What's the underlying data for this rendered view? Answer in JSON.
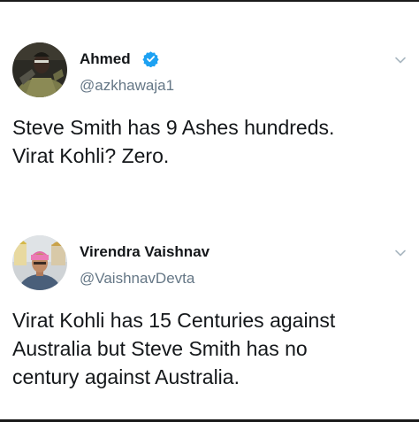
{
  "tweets": [
    {
      "display_name": "Ahmed",
      "verified": true,
      "handle": "@azkhawaja1",
      "text": "Steve Smith has 9 Ashes hundreds.\nVirat Kohli? Zero.",
      "avatar_icon": "user-avatar",
      "menu_icon": "chevron-down-icon"
    },
    {
      "display_name": "Virendra Vaishnav",
      "verified": false,
      "handle": "@VaishnavDevta",
      "text": "Virat Kohli has 15 Centuries against\nAustralia but Steve Smith has no\ncentury against Australia.",
      "avatar_icon": "user-avatar",
      "menu_icon": "chevron-down-icon"
    }
  ],
  "colors": {
    "verified_badge": "#1da1f2",
    "handle_text": "#657786",
    "body_text": "#14171a",
    "caret": "#aab8c2"
  }
}
